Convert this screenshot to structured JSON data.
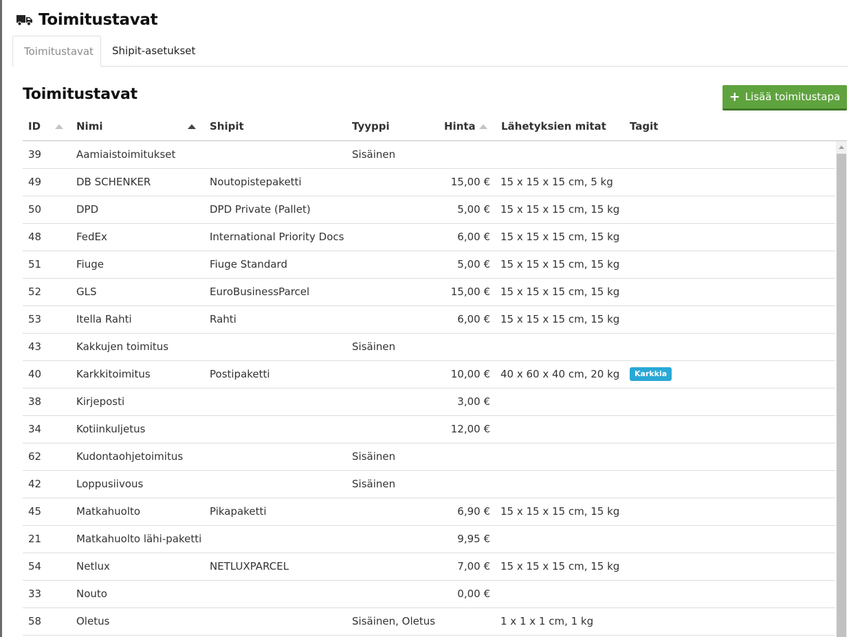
{
  "header": {
    "title": "Toimitustavat",
    "icon": "truck-icon"
  },
  "tabs": [
    {
      "label": "Toimitustavat",
      "active": true
    },
    {
      "label": "Shipit-asetukset",
      "active": false
    }
  ],
  "section": {
    "title": "Toimitustavat",
    "add_button": "Lisää toimitustapa",
    "add_icon": "plus-icon"
  },
  "colors": {
    "accent_green": "#5fa33e",
    "tag_blue": "#29a8d6"
  },
  "table": {
    "columns": {
      "id": "ID",
      "name": "Nimi",
      "shipit": "Shipit",
      "type": "Tyyppi",
      "price": "Hinta",
      "dims": "Lähetyksien mitat",
      "tags": "Tagit"
    },
    "rows": [
      {
        "id": "39",
        "name": "Aamiaistoimitukset",
        "shipit": "",
        "type": "Sisäinen",
        "price": "",
        "dims": "",
        "tag": ""
      },
      {
        "id": "49",
        "name": "DB SCHENKER",
        "shipit": "Noutopistepaketti",
        "type": "",
        "price": "15,00 €",
        "dims": "15 x 15 x 15 cm, 5 kg",
        "tag": ""
      },
      {
        "id": "50",
        "name": "DPD",
        "shipit": "DPD Private (Pallet)",
        "type": "",
        "price": "5,00 €",
        "dims": "15 x 15 x 15 cm, 15 kg",
        "tag": ""
      },
      {
        "id": "48",
        "name": "FedEx",
        "shipit": "International Priority Docs",
        "type": "",
        "price": "6,00 €",
        "dims": "15 x 15 x 15 cm, 15 kg",
        "tag": ""
      },
      {
        "id": "51",
        "name": "Fiuge",
        "shipit": "Fiuge Standard",
        "type": "",
        "price": "5,00 €",
        "dims": "15 x 15 x 15 cm, 15 kg",
        "tag": ""
      },
      {
        "id": "52",
        "name": "GLS",
        "shipit": "EuroBusinessParcel",
        "type": "",
        "price": "15,00 €",
        "dims": "15 x 15 x 15 cm, 15 kg",
        "tag": ""
      },
      {
        "id": "53",
        "name": "Itella Rahti",
        "shipit": "Rahti",
        "type": "",
        "price": "6,00 €",
        "dims": "15 x 15 x 15 cm, 15 kg",
        "tag": ""
      },
      {
        "id": "43",
        "name": "Kakkujen toimitus",
        "shipit": "",
        "type": "Sisäinen",
        "price": "",
        "dims": "",
        "tag": ""
      },
      {
        "id": "40",
        "name": "Karkkitoimitus",
        "shipit": "Postipaketti",
        "type": "",
        "price": "10,00 €",
        "dims": "40 x 60 x 40 cm, 20 kg",
        "tag": "Karkkia"
      },
      {
        "id": "38",
        "name": "Kirjeposti",
        "shipit": "",
        "type": "",
        "price": "3,00 €",
        "dims": "",
        "tag": ""
      },
      {
        "id": "34",
        "name": "Kotiinkuljetus",
        "shipit": "",
        "type": "",
        "price": "12,00 €",
        "dims": "",
        "tag": ""
      },
      {
        "id": "62",
        "name": "Kudontaohjetoimitus",
        "shipit": "",
        "type": "Sisäinen",
        "price": "",
        "dims": "",
        "tag": ""
      },
      {
        "id": "42",
        "name": "Loppusiivous",
        "shipit": "",
        "type": "Sisäinen",
        "price": "",
        "dims": "",
        "tag": ""
      },
      {
        "id": "45",
        "name": "Matkahuolto",
        "shipit": "Pikapaketti",
        "type": "",
        "price": "6,90 €",
        "dims": "15 x 15 x 15 cm, 15 kg",
        "tag": ""
      },
      {
        "id": "21",
        "name": "Matkahuolto lähi-paketti",
        "shipit": "",
        "type": "",
        "price": "9,95 €",
        "dims": "",
        "tag": ""
      },
      {
        "id": "54",
        "name": "Netlux",
        "shipit": "NETLUXPARCEL",
        "type": "",
        "price": "7,00 €",
        "dims": "15 x 15 x 15 cm, 15 kg",
        "tag": ""
      },
      {
        "id": "33",
        "name": "Nouto",
        "shipit": "",
        "type": "",
        "price": "0,00 €",
        "dims": "",
        "tag": ""
      },
      {
        "id": "58",
        "name": "Oletus",
        "shipit": "",
        "type": "Sisäinen, Oletus",
        "price": "",
        "dims": "1 x 1 x 1 cm, 1 kg",
        "tag": ""
      }
    ]
  }
}
